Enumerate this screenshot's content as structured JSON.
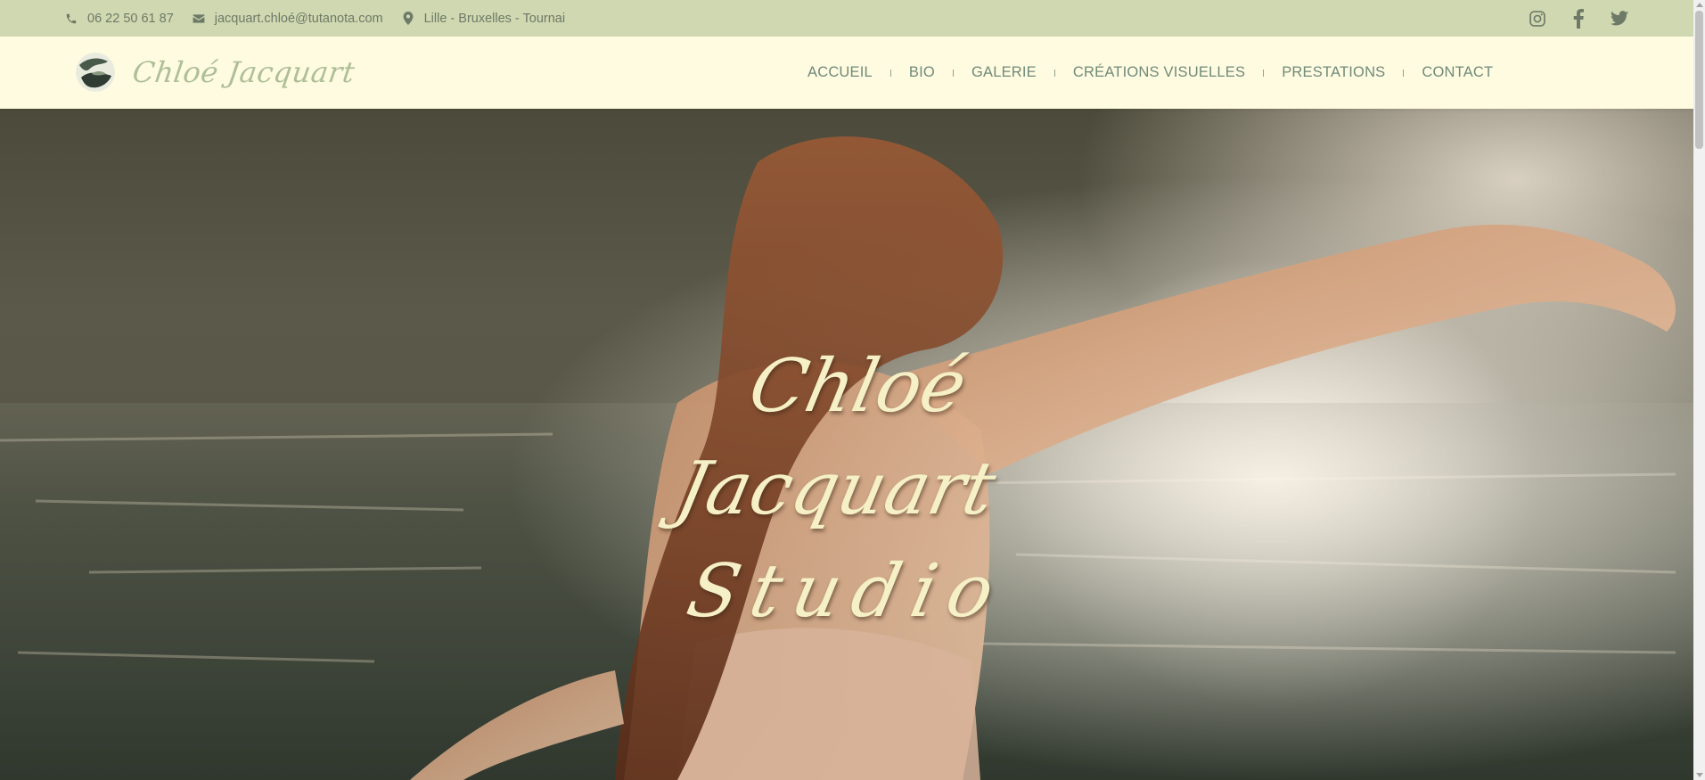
{
  "topbar": {
    "phone": "06 22 50 61 87",
    "email": "jacquart.chloé@tutanota.com",
    "location": "Lille - Bruxelles - Tournai",
    "socials": [
      "instagram-icon",
      "facebook-icon",
      "twitter-icon"
    ]
  },
  "header": {
    "logo_text": "Chloé Jacquart",
    "nav": [
      {
        "label": "ACCUEIL"
      },
      {
        "label": "BIO"
      },
      {
        "label": "GALERIE"
      },
      {
        "label": "CRÉATIONS VISUELLES"
      },
      {
        "label": "PRESTATIONS"
      },
      {
        "label": "CONTACT"
      }
    ]
  },
  "hero": {
    "title_line1": "Chloé Jacquart",
    "title_line2": "Studio"
  },
  "colors": {
    "topbar_bg": "#cfd8b0",
    "header_bg": "#fffbe0",
    "nav_text": "#6f8a7a",
    "hero_title": "#f5f0c6"
  }
}
